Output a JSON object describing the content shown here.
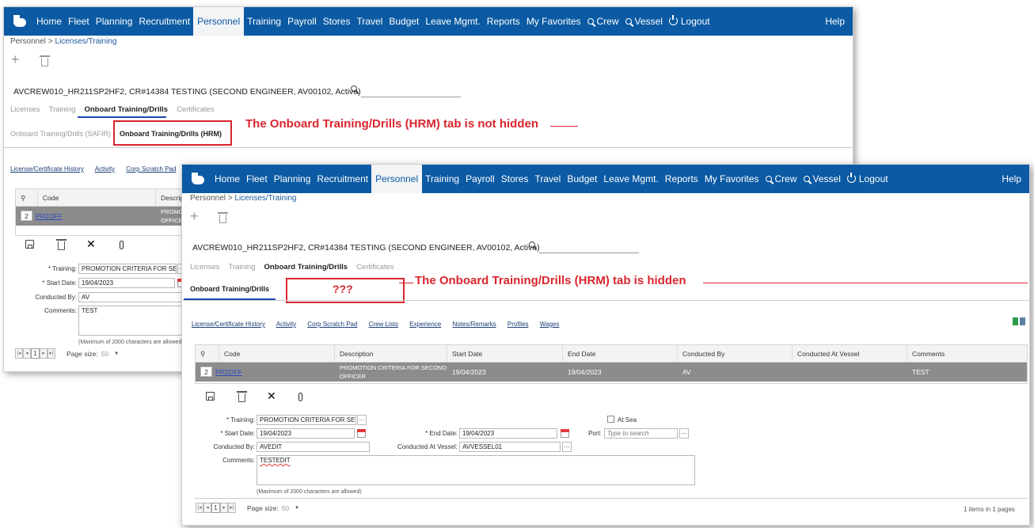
{
  "nav": {
    "items": [
      "Home",
      "Fleet",
      "Planning",
      "Recruitment",
      "Personnel",
      "Training",
      "Payroll",
      "Stores",
      "Travel",
      "Budget",
      "Leave Mgmt.",
      "Reports",
      "My Favorites"
    ],
    "crew": "Crew",
    "vessel": "Vessel",
    "logout": "Logout",
    "help": "Help"
  },
  "breadcrumb": {
    "root": "Personnel",
    "sep": ">",
    "current": "Licenses/Training"
  },
  "person": "AVCREW010_HR211SP2HF2, CR#14384 TESTING (SECOND ENGINEER, AV00102, Active)",
  "tabs": [
    "Licenses",
    "Training",
    "Onboard Training/Drills",
    "Certificates"
  ],
  "window1": {
    "subtab_safir": "Onboard Training/Drills (SAFIR)",
    "subtab_hrm": "Onboard Training/Drills (HRM)",
    "links": [
      "License/Certificate History",
      "Activity",
      "Corp Scratch Pad",
      "Cr"
    ],
    "grid_headers": [
      "Code",
      "Descript"
    ],
    "row": {
      "no": "2",
      "code": "PR2OFF",
      "desc_line1": "PROMOTI",
      "desc_line2": "OFFICER"
    },
    "form": {
      "training_label": "* Training:",
      "training_value": "PROMOTION CRITERIA FOR SECC",
      "start_label": "* Start Date:",
      "start_value": "19/04/2023",
      "conducted_label": "Conducted By:",
      "conducted_value": "AV",
      "comments_label": "Comments:",
      "comments_value": "TEST",
      "note": "(Maximum of 2000 characters are allowed"
    },
    "pager": {
      "page": "1",
      "label": "Page size:",
      "size": "50"
    },
    "annotation": "The Onboard Training/Drills (HRM) tab is not hidden"
  },
  "window2": {
    "subtab": "Onboard Training/Drills",
    "placeholder_text": "???",
    "links": [
      "License/Certificate History",
      "Activity",
      "Corp Scratch Pad",
      "Crew Lists",
      "Experience",
      "Notes/Remarks",
      "Profiles",
      "Wages"
    ],
    "grid_headers": [
      "Code",
      "Description",
      "Start Date",
      "End Date",
      "Conducted By",
      "Conducted At Vessel",
      "Comments"
    ],
    "row": {
      "no": "2",
      "code": "PR2OFF",
      "desc_line1": "PROMOTION CRITERIA FOR SECOND",
      "desc_line2": "OFFICER",
      "start": "19/04/2023",
      "end": "19/04/2023",
      "conducted_by": "AV",
      "vessel": "",
      "comments": "TEST"
    },
    "form": {
      "training_label": "* Training:",
      "training_value": "PROMOTION CRITERIA FOR SECC",
      "at_sea_label": "At Sea",
      "start_label": "* Start Date:",
      "start_value": "19/04/2023",
      "end_label": "* End Date:",
      "end_value": "19/04/2023",
      "port_label": "Port:",
      "port_placeholder": "Type to search",
      "conducted_label": "Conducted By:",
      "conducted_value": "AVEDIT",
      "vessel_label": "Conducted At Vessel:",
      "vessel_value": "AVVESSEL01",
      "comments_label": "Comments:",
      "comments_value": "TESTEDIT",
      "note": "(Maximum of 2000 characters are allowed)"
    },
    "pager": {
      "page": "1",
      "label": "Page size:",
      "size": "50",
      "summary": "1 items in 1 pages"
    },
    "annotation": "The Onboard Training/Drills (HRM) tab is hidden"
  },
  "colors": {
    "navbar": "#0b5aa3",
    "annotation": "#d9262e",
    "selected_row": "#8c8c8c",
    "tab_underline": "#1d49a8"
  }
}
